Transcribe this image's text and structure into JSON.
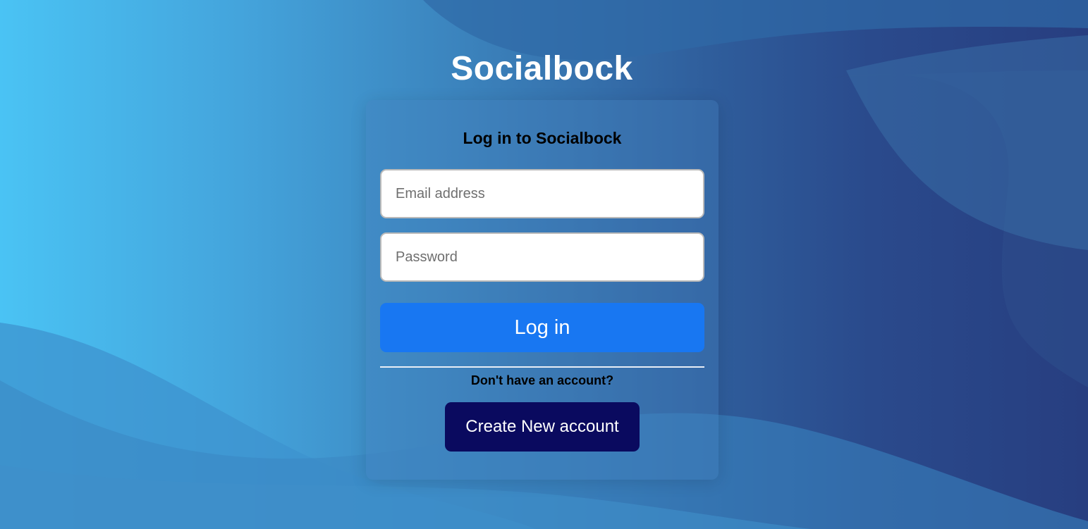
{
  "brand": {
    "title": "Socialbock"
  },
  "login_form": {
    "heading": "Log in to Socialbock",
    "email": {
      "placeholder": "Email address",
      "value": ""
    },
    "password": {
      "placeholder": "Password",
      "value": ""
    },
    "login_label": "Log in",
    "signup_prompt": "Don't have an account?",
    "create_account_label": "Create New account"
  },
  "colors": {
    "login_button": "#1877f2",
    "create_account_button": "#0a0a5f",
    "background_light": "#4ac3f4",
    "background_dark": "#273e80"
  }
}
